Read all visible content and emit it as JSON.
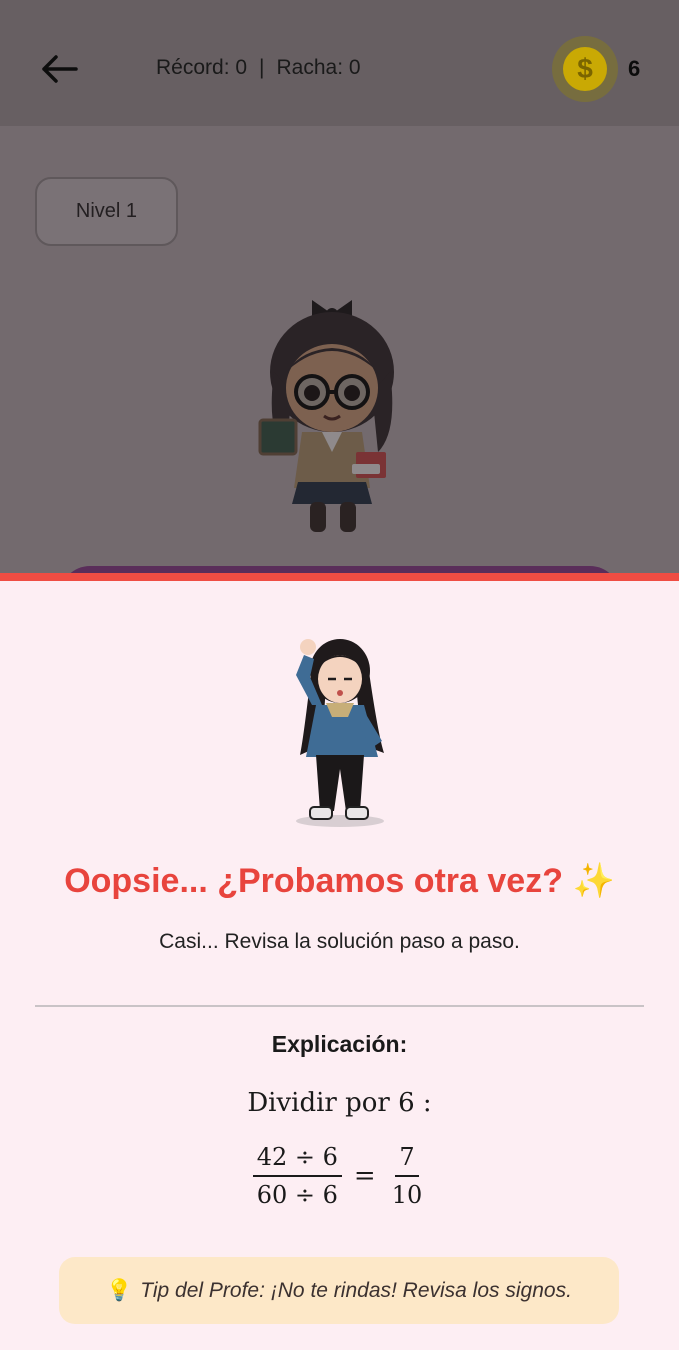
{
  "appbar": {
    "back_icon": "arrow-left-icon",
    "record_text": "Récord: 0",
    "separator": "|",
    "streak_text": "Racha: 0",
    "coin_icon": "dollar-coin-icon",
    "coin_symbol": "$",
    "coin_count": "6"
  },
  "level": {
    "label": "Nivel 1"
  },
  "dialog": {
    "title": "Oopsie... ¿Probamos otra vez?",
    "title_emoji": "✨",
    "subtitle": "Casi... Revisa la solución paso a paso.",
    "explanation_title": "Explicación:",
    "step_text": "Dividir por 6 :",
    "fraction_left": {
      "numerator": "42 ÷ 6",
      "denominator": "60 ÷ 6"
    },
    "equals": "=",
    "fraction_right": {
      "numerator": "7",
      "denominator": "10"
    },
    "tip_icon": "lightbulb-icon",
    "tip_text": "Tip del Profe: ¡No te rindas! Revisa los signos."
  },
  "colors": {
    "accent_red": "#e8443d",
    "sheet_bg": "#fdeef3",
    "tip_bg": "#fde8c8",
    "coin": "#c9a904"
  }
}
